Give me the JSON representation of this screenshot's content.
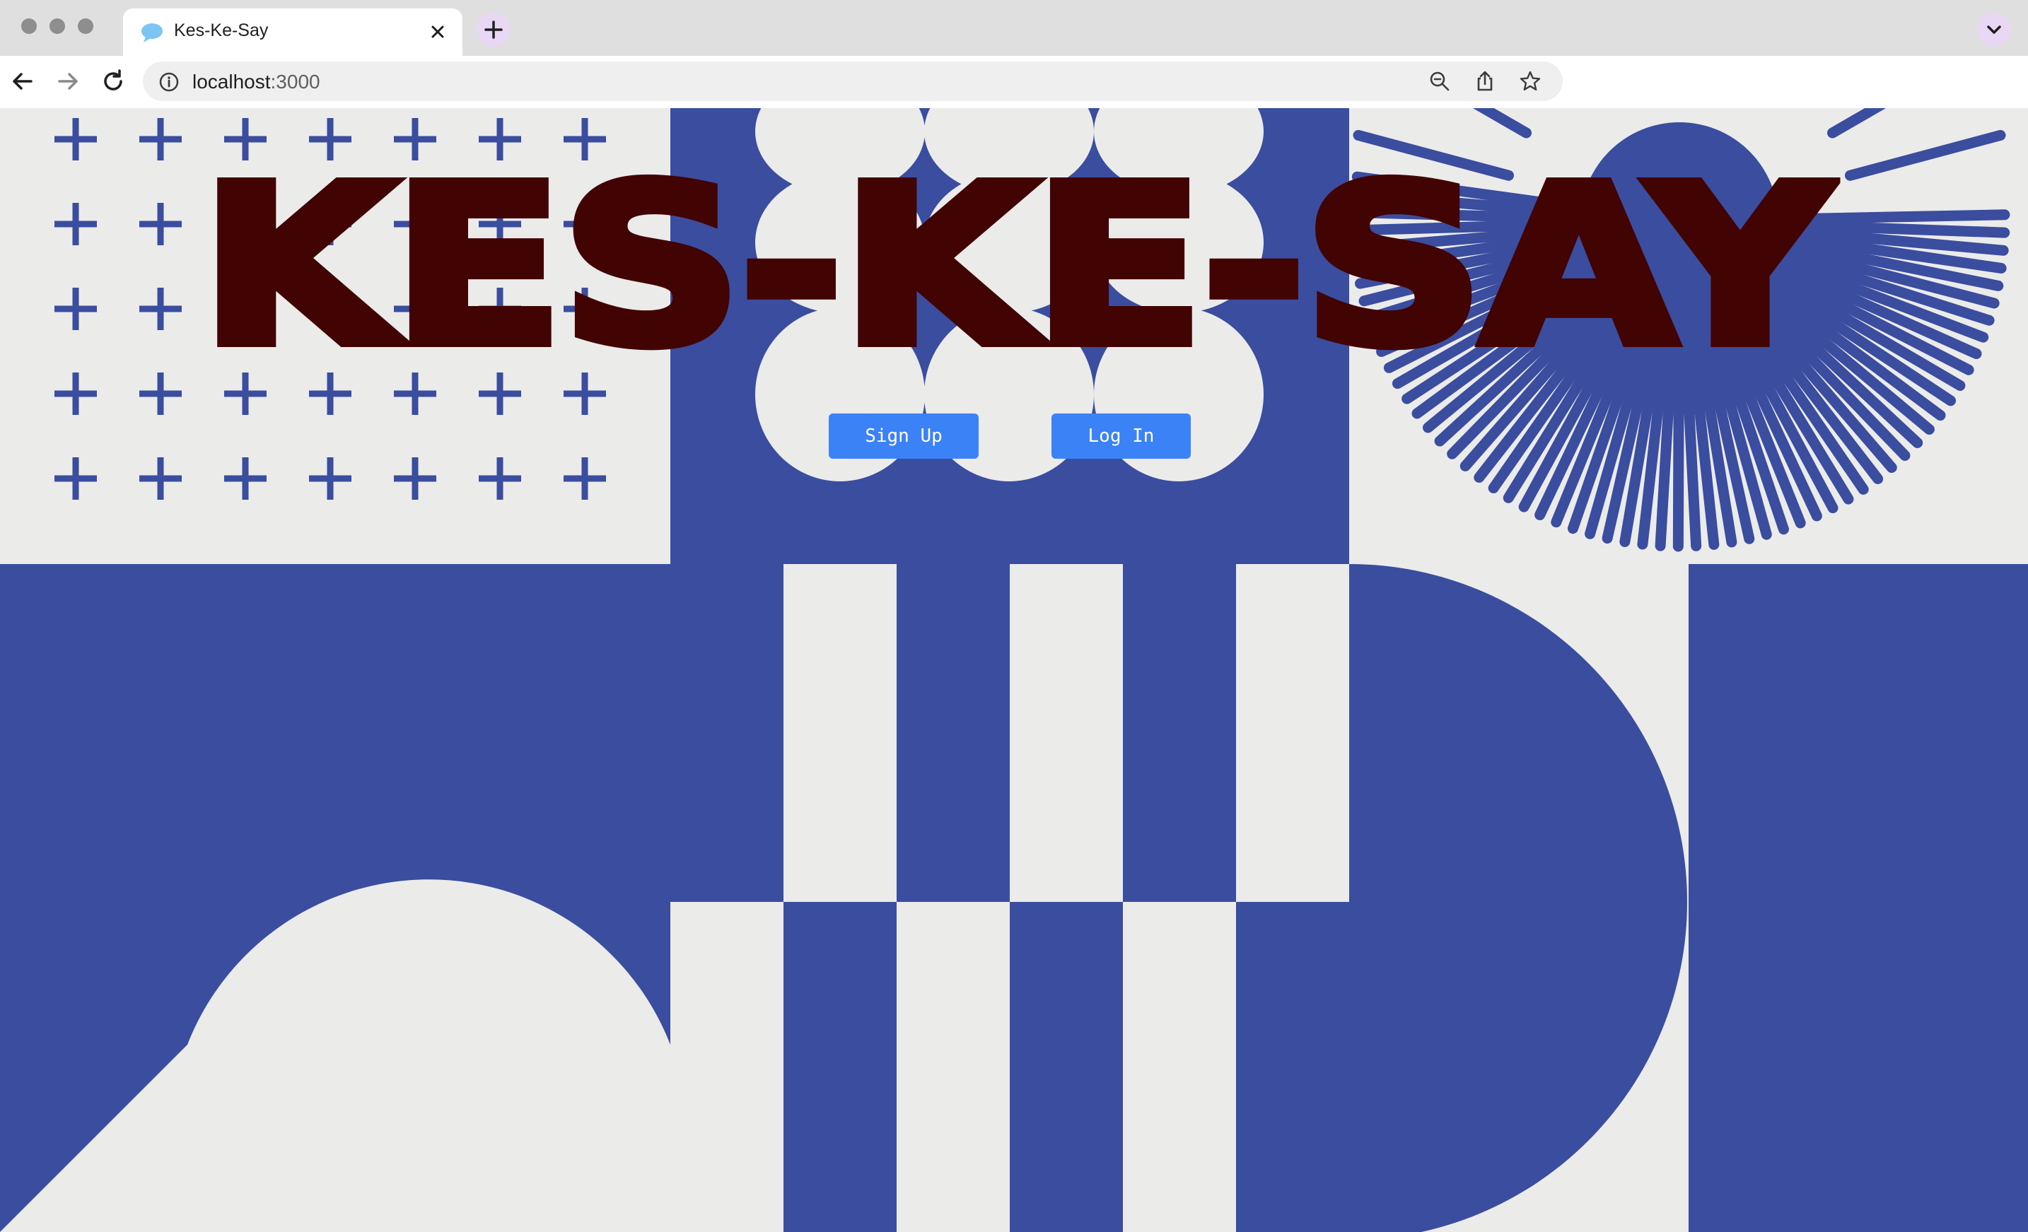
{
  "browser": {
    "tab": {
      "title": "Kes-Ke-Say",
      "favicon": "speech-bubble-icon",
      "close_icon": "close-icon"
    },
    "new_tab_icon": "plus-icon",
    "tab_menu_icon": "chevron-down-icon",
    "nav": {
      "back_icon": "back-arrow-icon",
      "forward_icon": "forward-arrow-icon",
      "reload_icon": "reload-icon"
    },
    "address_bar": {
      "host": "localhost",
      "port": ":3000",
      "info_icon": "info-icon"
    },
    "omnibox_icons": [
      "zoom-out-icon",
      "share-icon",
      "bookmark-star-icon"
    ]
  },
  "page": {
    "title": "KES-KE-SAY",
    "buttons": {
      "sign_up": "Sign Up",
      "log_in": "Log In"
    }
  },
  "colors": {
    "blue": "#3a4d9f",
    "cream": "#ebebea",
    "title": "#420303",
    "button": "#3b82f6",
    "button_text": "#ffffff"
  }
}
